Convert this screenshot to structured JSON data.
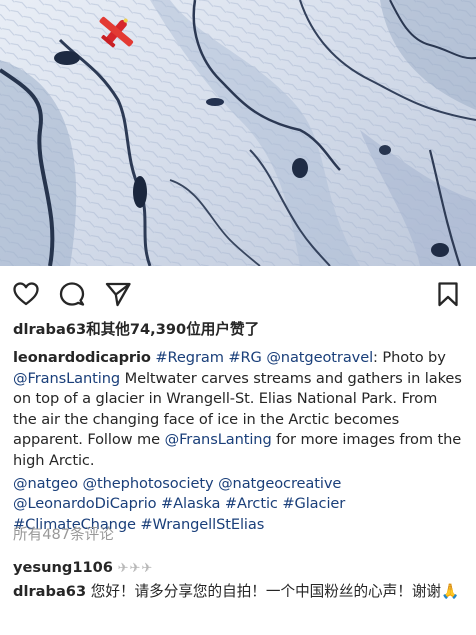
{
  "post": {
    "likes_text": "dlraba63和其他74,390位用户赞了",
    "caption": {
      "username": "leonardodicaprio",
      "tag_regram": "#Regram",
      "tag_rg": "#RG",
      "mention_natgeotravel": "@natgeotravel",
      "text_1": ": Photo by",
      "mention_franslanting_1": "@FransLanting",
      "text_2": " Meltwater carves streams and gathers in lakes on top of a glacier in Wrangell-St. Elias National Park. From the air the changing face of ice in the Arctic becomes apparent. Follow me ",
      "mention_franslanting_2": "@FransLanting",
      "text_3": " for more images from the high Arctic.",
      "tags": [
        "@natgeo",
        "@thephotosociety",
        "@natgeocreative",
        "@LeonardoDiCaprio",
        "#Alaska",
        "#Arctic",
        "#Glacier",
        "#ClimateChange",
        "#WrangellStElias"
      ]
    },
    "view_comments": "所有487条评论",
    "comments": [
      {
        "user": "yesung1106",
        "text": "",
        "emoji": "✈✈✈"
      },
      {
        "user": "dlraba63",
        "text": "您好！请多分享您的自拍！一个中国粉丝的心声！谢谢",
        "emoji": "🙏"
      }
    ]
  },
  "icons": {
    "like": "heart-icon",
    "comment": "comment-bubble-icon",
    "share": "paper-plane-icon",
    "save": "bookmark-icon"
  },
  "colors": {
    "link": "#1a3f7a",
    "muted": "#999999",
    "plane": "#d6262b"
  }
}
